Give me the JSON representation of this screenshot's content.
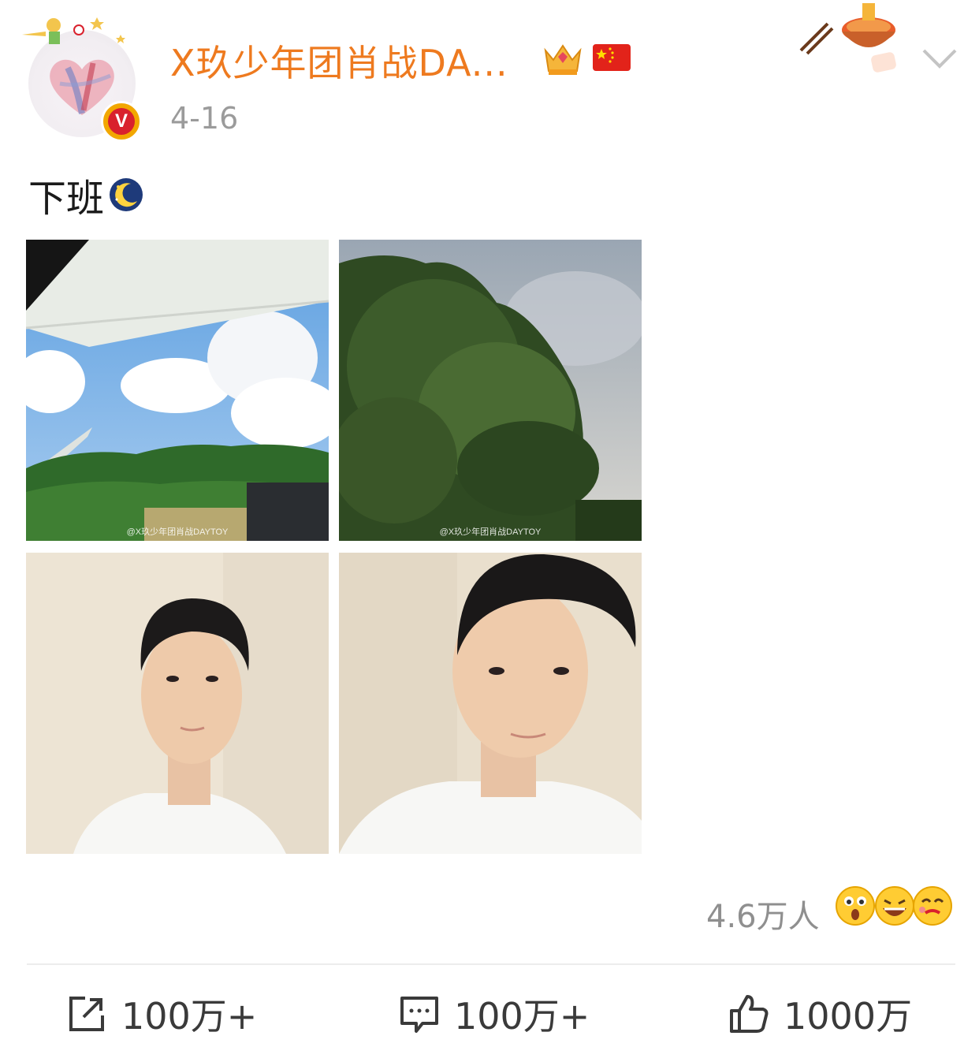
{
  "post": {
    "username": "X玖少年团肖战DA...",
    "date": "4-16",
    "text": "下班",
    "photos": [
      {
        "watermark": "@X玖少年团肖战DAYTOY"
      },
      {
        "watermark": "@X玖少年团肖战DAYTOY"
      },
      {
        "watermark": ""
      },
      {
        "watermark": ""
      }
    ]
  },
  "reactions": {
    "count": "4.6万人",
    "emojis": [
      "surprised-emoji",
      "laughing-emoji",
      "love-emoji"
    ]
  },
  "actions": {
    "share_count": "100万+",
    "comment_count": "100万+",
    "like_count": "1000万"
  },
  "icons": {
    "verified": "V",
    "crown": "crown-icon",
    "flag": "china-flag-icon",
    "moon": "moon-icon",
    "more": "chevron-down-icon"
  },
  "colors": {
    "username": "#ee7a1f",
    "date": "#9b9b9b",
    "verified_badge": "#d9212d"
  }
}
